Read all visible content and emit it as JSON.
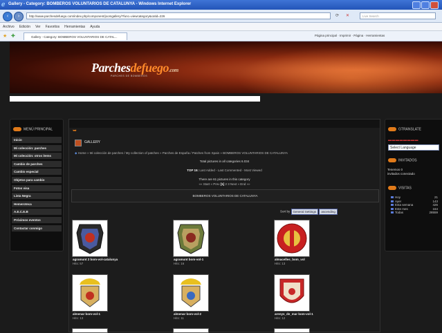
{
  "browser": {
    "title": "Gallery - Category: BOMBEROS VOLUNTARIOS DE CATALUNYA - Windows Internet Explorer",
    "url": "http://www.parchesdefuego.com/index.php/component/joomgallery/?func=viewcategory&catid=226",
    "search_placeholder": "Live Search",
    "menu": [
      "Archivo",
      "Edición",
      "Ver",
      "Favoritos",
      "Herramientas",
      "Ayuda"
    ],
    "tab_label": "Gallery - Category: BOMBEROS VOLUNTARIOS DE CATAL...",
    "right_cmds": "Página principal  ·  Imprimir  ·  Página  ·  Herramientas"
  },
  "site": {
    "logo_main": "Parches",
    "logo_accent": "defuego",
    "logo_suffix": ".com",
    "tagline": "PARCHES DE BOMBEROS"
  },
  "left_menu": {
    "title": "MENÚ PRINCIPAL",
    "items": [
      "Inicio",
      "Mi colección: parches",
      "Mi colección: otros items",
      "Cambio de parches",
      "Cambio especial",
      "Objetos para cambio",
      "Fotos visa",
      "Lista Negra",
      "Hemeroteca",
      "A.E.C.E.B",
      "Próximos eventos",
      "Contactar conmigo"
    ]
  },
  "gallery": {
    "title": "GALLERY",
    "breadcrumb": "Home » Mi colección de parches / My collection of patches » Parches de España / Patches from Spain » BOMBEROS VOLUNTARIOS DE CATALUNYA",
    "totals": "Total pictures in all categories 6.034",
    "top15_label": "TOP 15:",
    "top15_links": "Last Added - Last Commented - Most Viewed",
    "count": "There are 61 pictures in this category",
    "pager": {
      "prev": "«« Start  « Prev",
      "current": "[1]",
      "pages": "2  3",
      "next": "Next »  End »»"
    },
    "category_name": "BOMBEROS VOLUNTARIOS DE CATALUNYA",
    "sort_label": "Sort by",
    "sort_value": "General Settings",
    "order_value": "ascending",
    "items": [
      {
        "caption": "agramunt 2 bom-vol-catalunya",
        "hits": "Hits: 57"
      },
      {
        "caption": "agramunt bom-vol-1",
        "hits": "Hits: 16"
      },
      {
        "caption": "almacelles_bom_vol",
        "hits": "Hits: 13"
      },
      {
        "caption": "almenar bom-vol-1",
        "hits": "Hits: 13"
      },
      {
        "caption": "almenar bom-vol-2",
        "hits": "Hits: 11"
      },
      {
        "caption": "arenys_de_mar bom-vol-1",
        "hits": "Hits: 12"
      }
    ]
  },
  "right_col": {
    "translate_title": "GTRANSLATE",
    "flags": "▬▬▬▬▬▬▬▬",
    "language_select": "Select Language",
    "who_title": "INVITADOS",
    "who_line1": "Tenemos 0",
    "who_line2": "invitados conectado",
    "visits_title": "VISITAS",
    "visits": [
      {
        "label": "Hoy",
        "value": "21"
      },
      {
        "label": "Ayer",
        "value": "143"
      },
      {
        "label": "Esta semana",
        "value": "426"
      },
      {
        "label": "Este mes",
        "value": "164"
      },
      {
        "label": "Todas",
        "value": "28559"
      }
    ]
  }
}
